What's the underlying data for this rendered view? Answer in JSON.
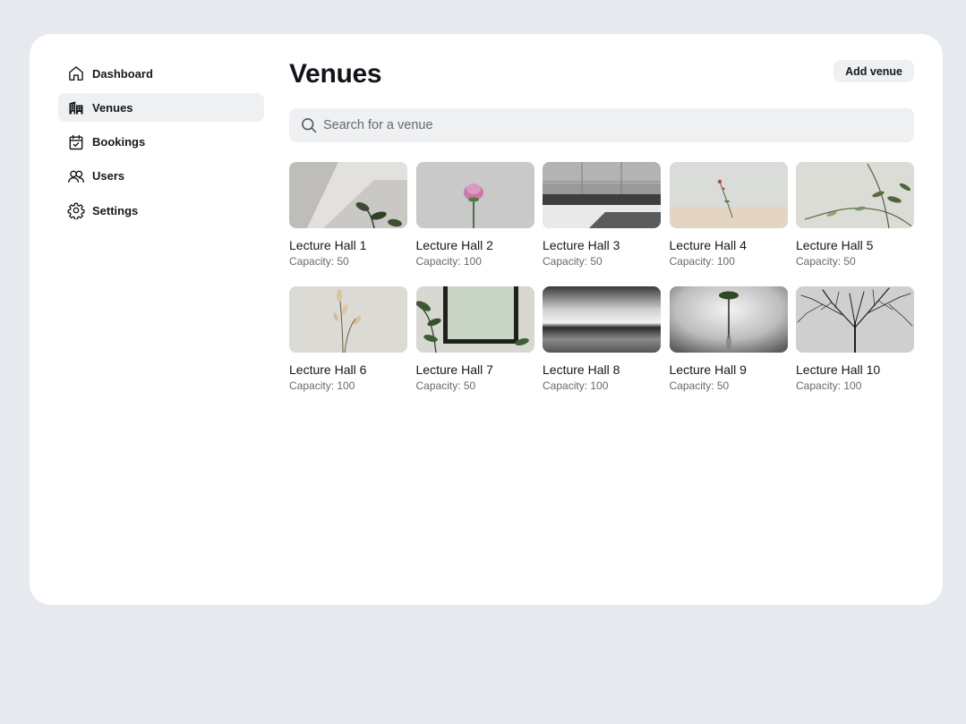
{
  "sidebar": {
    "items": [
      {
        "label": "Dashboard",
        "icon": "home-icon",
        "active": false
      },
      {
        "label": "Venues",
        "icon": "building-icon",
        "active": true
      },
      {
        "label": "Bookings",
        "icon": "calendar-check-icon",
        "active": false
      },
      {
        "label": "Users",
        "icon": "users-icon",
        "active": false
      },
      {
        "label": "Settings",
        "icon": "gear-icon",
        "active": false
      }
    ]
  },
  "header": {
    "title": "Venues",
    "add_button_label": "Add venue"
  },
  "search": {
    "placeholder": "Search for a venue",
    "value": ""
  },
  "venues": [
    {
      "name": "Lecture Hall 1",
      "capacity": "Capacity: 50",
      "image": "plant-shadow-wall"
    },
    {
      "name": "Lecture Hall 2",
      "capacity": "Capacity: 100",
      "image": "pink-flower"
    },
    {
      "name": "Lecture Hall 3",
      "capacity": "Capacity: 50",
      "image": "grey-tiles-floor"
    },
    {
      "name": "Lecture Hall 4",
      "capacity": "Capacity: 100",
      "image": "small-flower-sand"
    },
    {
      "name": "Lecture Hall 5",
      "capacity": "Capacity: 50",
      "image": "branches-leaves"
    },
    {
      "name": "Lecture Hall 6",
      "capacity": "Capacity: 100",
      "image": "dried-grass"
    },
    {
      "name": "Lecture Hall 7",
      "capacity": "Capacity: 50",
      "image": "frame-with-leaves"
    },
    {
      "name": "Lecture Hall 8",
      "capacity": "Capacity: 100",
      "image": "blurred-seascape"
    },
    {
      "name": "Lecture Hall 9",
      "capacity": "Capacity: 50",
      "image": "leaf-in-vase"
    },
    {
      "name": "Lecture Hall 10",
      "capacity": "Capacity: 100",
      "image": "bare-tree"
    }
  ],
  "colors": {
    "page_background": "#e6e9ed",
    "card_background": "#ffffff",
    "muted_background": "#eef0f2",
    "muted_text": "#646a70"
  }
}
